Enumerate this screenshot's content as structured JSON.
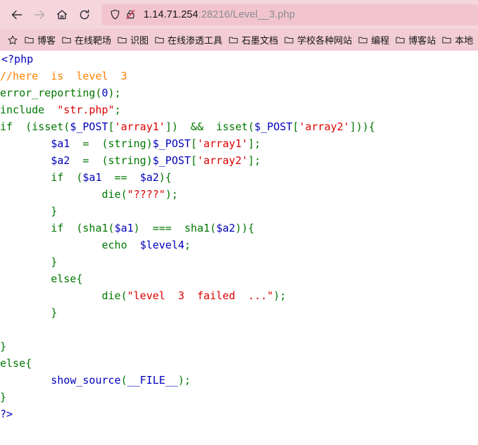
{
  "browser": {
    "nav": {
      "back_icon": "back-arrow-icon",
      "forward_icon": "forward-arrow-icon",
      "home_icon": "home-icon",
      "reload_icon": "reload-icon"
    },
    "urlbar": {
      "shield_icon": "shield-icon",
      "lock_icon": "lock-crossed-icon",
      "host": "1.14.71.254",
      "rest": ":28216/Level__3.php",
      "full_url": "1.14.71.254:28216/Level__3.php"
    },
    "bookmarks": {
      "star_icon": "star-outline-icon",
      "items": [
        {
          "icon": "folder-icon",
          "label": "博客"
        },
        {
          "icon": "folder-icon",
          "label": "在线靶场"
        },
        {
          "icon": "folder-icon",
          "label": "识图"
        },
        {
          "icon": "folder-icon",
          "label": "在线渗透工具"
        },
        {
          "icon": "folder-icon",
          "label": "石墨文档"
        },
        {
          "icon": "folder-icon",
          "label": "学校各种网站"
        },
        {
          "icon": "folder-icon",
          "label": "编程"
        },
        {
          "icon": "folder-icon",
          "label": "博客站"
        },
        {
          "icon": "folder-icon",
          "label": "本地"
        }
      ]
    }
  },
  "colors": {
    "toolbar_bg": "#f6d6dd",
    "urlbar_bg": "#f2c5ce",
    "bookmarks_bg": "#f2cdd5",
    "page_bg": "#ffffff",
    "php_keyword": "#007700",
    "php_string": "#dd0000",
    "php_comment": "#ff8000",
    "php_variable": "#0000bb",
    "php_default": "#000000"
  },
  "source": {
    "language": "php",
    "lines": [
      [
        {
          "t": "<?php",
          "c": "c-var"
        }
      ],
      [
        {
          "t": "//here  is  level  3",
          "c": "c-cmt"
        }
      ],
      [
        {
          "t": "error_reporting",
          "c": "c-kw"
        },
        {
          "t": "(",
          "c": "c-kw"
        },
        {
          "t": "0",
          "c": "c-var"
        },
        {
          "t": ")",
          "c": "c-kw"
        },
        {
          "t": ";",
          "c": "c-kw"
        }
      ],
      [
        {
          "t": "include ",
          "c": "c-kw"
        },
        {
          "t": " \"str.php\"",
          "c": "c-str"
        },
        {
          "t": ";",
          "c": "c-kw"
        }
      ],
      [
        {
          "t": "if  (isset(",
          "c": "c-kw"
        },
        {
          "t": "$_POST",
          "c": "c-var"
        },
        {
          "t": "[",
          "c": "c-kw"
        },
        {
          "t": "'array1'",
          "c": "c-str"
        },
        {
          "t": "])  &&  isset(",
          "c": "c-kw"
        },
        {
          "t": "$_POST",
          "c": "c-var"
        },
        {
          "t": "[",
          "c": "c-kw"
        },
        {
          "t": "'array2'",
          "c": "c-str"
        },
        {
          "t": "])){",
          "c": "c-kw"
        }
      ],
      [
        {
          "t": "        ",
          "c": "c-kw"
        },
        {
          "t": "$a1",
          "c": "c-var"
        },
        {
          "t": "  =  (string)",
          "c": "c-kw"
        },
        {
          "t": "$_POST",
          "c": "c-var"
        },
        {
          "t": "[",
          "c": "c-kw"
        },
        {
          "t": "'array1'",
          "c": "c-str"
        },
        {
          "t": "];",
          "c": "c-kw"
        }
      ],
      [
        {
          "t": "        ",
          "c": "c-kw"
        },
        {
          "t": "$a2",
          "c": "c-var"
        },
        {
          "t": "  =  (string)",
          "c": "c-kw"
        },
        {
          "t": "$_POST",
          "c": "c-var"
        },
        {
          "t": "[",
          "c": "c-kw"
        },
        {
          "t": "'array2'",
          "c": "c-str"
        },
        {
          "t": "];",
          "c": "c-kw"
        }
      ],
      [
        {
          "t": "        if  (",
          "c": "c-kw"
        },
        {
          "t": "$a1",
          "c": "c-var"
        },
        {
          "t": "  ==  ",
          "c": "c-kw"
        },
        {
          "t": "$a2",
          "c": "c-var"
        },
        {
          "t": "){",
          "c": "c-kw"
        }
      ],
      [
        {
          "t": "                die(",
          "c": "c-kw"
        },
        {
          "t": "\"????\"",
          "c": "c-str"
        },
        {
          "t": ");",
          "c": "c-kw"
        }
      ],
      [
        {
          "t": "        }",
          "c": "c-kw"
        }
      ],
      [
        {
          "t": "        if  (sha1(",
          "c": "c-kw"
        },
        {
          "t": "$a1",
          "c": "c-var"
        },
        {
          "t": ")  ===  sha1(",
          "c": "c-kw"
        },
        {
          "t": "$a2",
          "c": "c-var"
        },
        {
          "t": ")){",
          "c": "c-kw"
        }
      ],
      [
        {
          "t": "                echo  ",
          "c": "c-kw"
        },
        {
          "t": "$level4",
          "c": "c-var"
        },
        {
          "t": ";",
          "c": "c-kw"
        }
      ],
      [
        {
          "t": "        }",
          "c": "c-kw"
        }
      ],
      [
        {
          "t": "        else{",
          "c": "c-kw"
        }
      ],
      [
        {
          "t": "                die(",
          "c": "c-kw"
        },
        {
          "t": "\"level  3  failed  ...\"",
          "c": "c-str"
        },
        {
          "t": ");",
          "c": "c-kw"
        }
      ],
      [
        {
          "t": "        }",
          "c": "c-kw"
        }
      ],
      [
        {
          "t": "",
          "c": "c-kw"
        }
      ],
      [
        {
          "t": "}",
          "c": "c-kw"
        }
      ],
      [
        {
          "t": "else{",
          "c": "c-kw"
        }
      ],
      [
        {
          "t": "        show_source",
          "c": "c-var"
        },
        {
          "t": "(",
          "c": "c-kw"
        },
        {
          "t": "__FILE__",
          "c": "c-var"
        },
        {
          "t": ");",
          "c": "c-kw"
        }
      ],
      [
        {
          "t": "}",
          "c": "c-kw"
        }
      ],
      [
        {
          "t": "?>",
          "c": "c-var"
        }
      ]
    ]
  }
}
